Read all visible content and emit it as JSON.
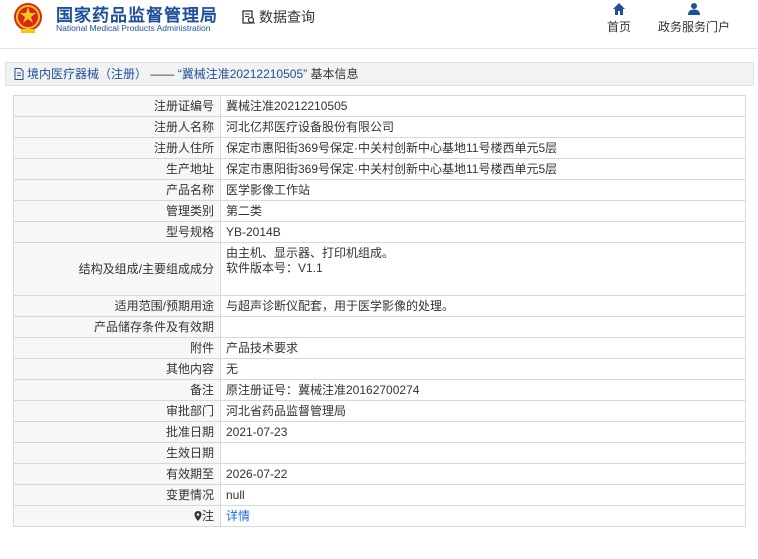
{
  "header": {
    "brand_cn": "国家药品监督管理局",
    "brand_en": "National Medical Products Administration",
    "query_label": "数据查询",
    "nav": [
      {
        "label": "首页",
        "icon": "home-icon"
      },
      {
        "label": "政务服务门户",
        "icon": "user-icon"
      }
    ]
  },
  "page_title": {
    "category": "境内医疗器械（注册）",
    "separator": "——",
    "record": "“冀械注准20212210505”",
    "suffix": "基本信息"
  },
  "details": [
    {
      "label": "注册证编号",
      "value": "冀械注准20212210505"
    },
    {
      "label": "注册人名称",
      "value": "河北亿邦医疗设备股份有限公司"
    },
    {
      "label": "注册人住所",
      "value": "保定市惠阳街369号保定·中关村创新中心基地11号楼西单元5层"
    },
    {
      "label": "生产地址",
      "value": "保定市惠阳街369号保定·中关村创新中心基地11号楼西单元5层"
    },
    {
      "label": "产品名称",
      "value": "医学影像工作站"
    },
    {
      "label": "管理类别",
      "value": "第二类"
    },
    {
      "label": "型号规格",
      "value": "YB-2014B"
    },
    {
      "label": "结构及组成/主要组成成分",
      "value": "由主机、显示器、打印机组成。",
      "value2": "软件版本号：V1.1"
    },
    {
      "label": "适用范围/预期用途",
      "value": "与超声诊断仪配套，用于医学影像的处理。"
    },
    {
      "label": "产品储存条件及有效期",
      "value": ""
    },
    {
      "label": "附件",
      "value": "产品技术要求"
    },
    {
      "label": "其他内容",
      "value": "无"
    },
    {
      "label": "备注",
      "value": "原注册证号：冀械注准20162700274"
    },
    {
      "label": "审批部门",
      "value": "河北省药品监督管理局"
    },
    {
      "label": "批准日期",
      "value": "2021-07-23"
    },
    {
      "label": "生效日期",
      "value": ""
    },
    {
      "label": "有效期至",
      "value": "2026-07-22"
    },
    {
      "label": "变更情况",
      "value": "null"
    },
    {
      "label": "注",
      "value": "详情"
    }
  ],
  "colors": {
    "brand_blue": "#1e4f9c",
    "link_blue": "#1e6bd6",
    "emblem_red": "#d7261e",
    "emblem_gold": "#f5c518"
  }
}
